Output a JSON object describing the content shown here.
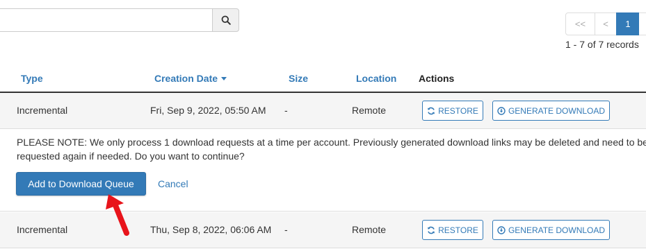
{
  "search": {
    "value": "",
    "placeholder": "",
    "button_icon": "search-icon"
  },
  "pagination": {
    "first_label": "<<",
    "prev_label": "<",
    "current_page": "1",
    "records_text": "1 - 7 of 7 records"
  },
  "table": {
    "headers": {
      "type": "Type",
      "creation_date": "Creation Date",
      "size": "Size",
      "location": "Location",
      "actions": "Actions"
    },
    "sort_column": "Creation Date",
    "sort_direction": "descending",
    "rows": [
      {
        "type": "Incremental",
        "date": "Fri, Sep 9, 2022, 05:50 AM",
        "size": "-",
        "location": "Remote",
        "restore_label": "RESTORE",
        "generate_label": "GENERATE DOWNLOAD"
      },
      {
        "type": "Incremental",
        "date": "Thu, Sep 8, 2022, 06:06 AM",
        "size": "-",
        "location": "Remote",
        "restore_label": "RESTORE",
        "generate_label": "GENERATE DOWNLOAD"
      }
    ]
  },
  "note": {
    "text": "PLEASE NOTE: We only process 1 download requests at a time per account. Previously generated download links may be deleted and need to be requested again if needed. Do you want to continue?",
    "confirm_label": "Add to Download Queue",
    "cancel_label": "Cancel"
  },
  "icons": {
    "restore": "refresh-icon",
    "generate": "download-circle-icon",
    "annotation": "red-arrow-icon"
  },
  "colors": {
    "primary": "#337ab7",
    "row_background": "#f5f5f5",
    "annotation": "#e8141b"
  }
}
